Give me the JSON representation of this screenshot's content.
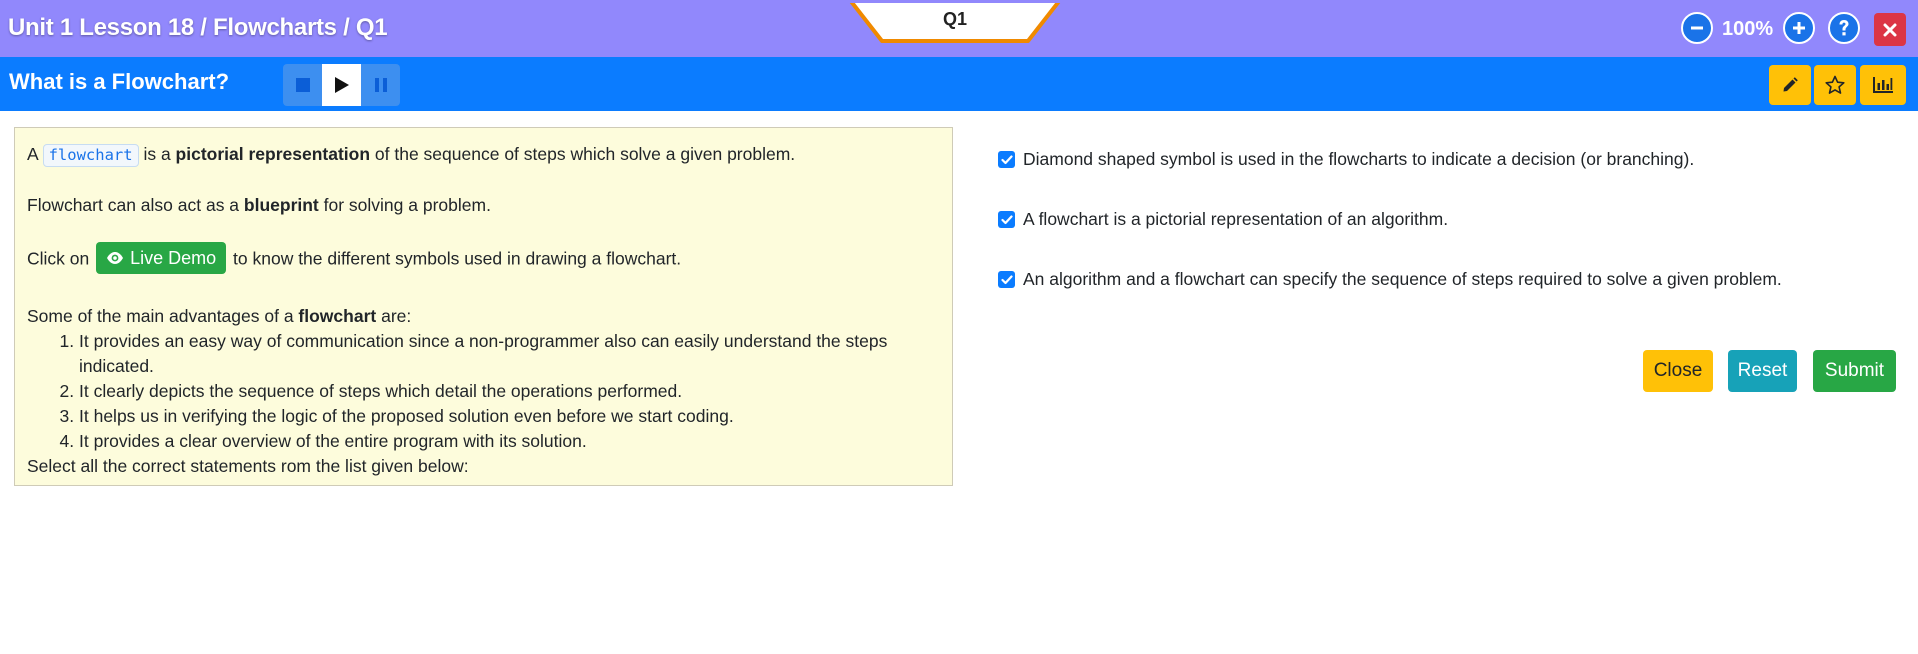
{
  "header": {
    "breadcrumb": "Unit 1 Lesson 18 / Flowcharts / Q1",
    "question_tab": "Q1",
    "zoom_level": "100%"
  },
  "subheader": {
    "title": "What is a Flowchart?"
  },
  "content": {
    "intro_a": "A ",
    "intro_code": "flowchart",
    "intro_b": " is a ",
    "intro_bold": "pictorial representation",
    "intro_c": " of the sequence of steps which solve a given problem.",
    "blueprint_a": "Flowchart can also act as a ",
    "blueprint_bold": "blueprint",
    "blueprint_b": " for solving a problem.",
    "click_a": "Click on ",
    "live_demo_label": "Live Demo",
    "click_b": " to know the different symbols used in drawing a flowchart.",
    "adv_a": "Some of the main advantages of a ",
    "adv_bold": "flowchart",
    "adv_b": " are:",
    "advantages": [
      "It provides an easy way of communication since a non-programmer also can easily understand the steps indicated.",
      "It clearly depicts the sequence of steps which detail the operations performed.",
      "It helps us in verifying the logic of the proposed solution even before we start coding.",
      "It provides a clear overview of the entire program with its solution."
    ],
    "instruction": "Select all the correct statements rom the list given below:"
  },
  "options": [
    {
      "label": "Diamond shaped symbol is used in the flowcharts to indicate a decision (or branching).",
      "checked": true
    },
    {
      "label": "A flowchart is a pictorial representation of an algorithm.",
      "checked": true
    },
    {
      "label": "An algorithm and a flowchart can specify the sequence of steps required to solve a given problem.",
      "checked": true
    }
  ],
  "actions": {
    "close": "Close",
    "reset": "Reset",
    "submit": "Submit"
  },
  "icons": {
    "zoom_out": "minus-circle-icon",
    "zoom_in": "plus-circle-icon",
    "help": "question-icon",
    "close": "close-icon",
    "stop": "stop-icon",
    "play": "play-icon",
    "pause": "pause-icon",
    "pencil": "pencil-icon",
    "star": "star-icon",
    "chart": "bar-chart-icon",
    "eye": "eye-icon"
  },
  "colors": {
    "topbar": "#9188fc",
    "subbar": "#0b7cff",
    "panel_bg": "#fdfcdc",
    "warning": "#ffc107",
    "info": "#17a2b8",
    "success": "#28a745",
    "danger": "#dc3545",
    "tab_border": "#f08a00"
  }
}
